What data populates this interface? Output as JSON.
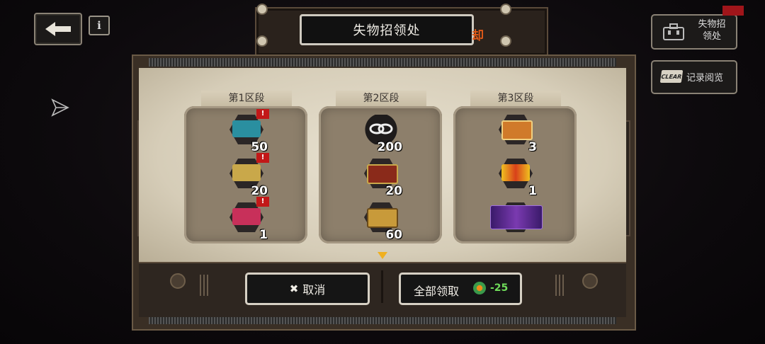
{
  "title": "失物招领处",
  "title_tag": "却",
  "info_label": "i",
  "right_buttons": {
    "lost_found": "失物招\n领处",
    "record": "记录阅览",
    "clear_icon_text": "CLEAR"
  },
  "sections": [
    {
      "label": "第1区段",
      "items": [
        {
          "qty": "50",
          "alert": "!",
          "icon": "blue-ticket-icon",
          "color": "#2a8fa0"
        },
        {
          "qty": "20",
          "alert": "!",
          "icon": "gold-ticket-icon",
          "color": "#c9a84a"
        },
        {
          "qty": "1",
          "alert": "!",
          "icon": "pink-ticket-icon",
          "color": "#c8305a"
        }
      ]
    },
    {
      "label": "第2区段",
      "items": [
        {
          "qty": "200",
          "alert": "",
          "icon": "chain-link-icon",
          "color": "#e8e8e8"
        },
        {
          "qty": "20",
          "alert": "",
          "icon": "red-chest-icon",
          "color": "#8a2a1a"
        },
        {
          "qty": "60",
          "alert": "",
          "icon": "gold-chest-icon",
          "color": "#c89a3a"
        }
      ]
    },
    {
      "label": "第3区段",
      "items": [
        {
          "qty": "3",
          "alert": "",
          "icon": "orange-ticket-icon",
          "color": "#d07a2a"
        },
        {
          "qty": "1",
          "alert": "",
          "icon": "red-gold-ticket-icon",
          "color": "#d8401a"
        },
        {
          "qty": "",
          "alert": "",
          "icon": "purple-card-icon",
          "color": "#5a2a8a"
        }
      ]
    }
  ],
  "buttons": {
    "cancel": "取消",
    "cancel_icon": "✖",
    "claim_all": "全部领取",
    "claim_cost": "-25",
    "coin_icon": "green-coin-icon"
  }
}
